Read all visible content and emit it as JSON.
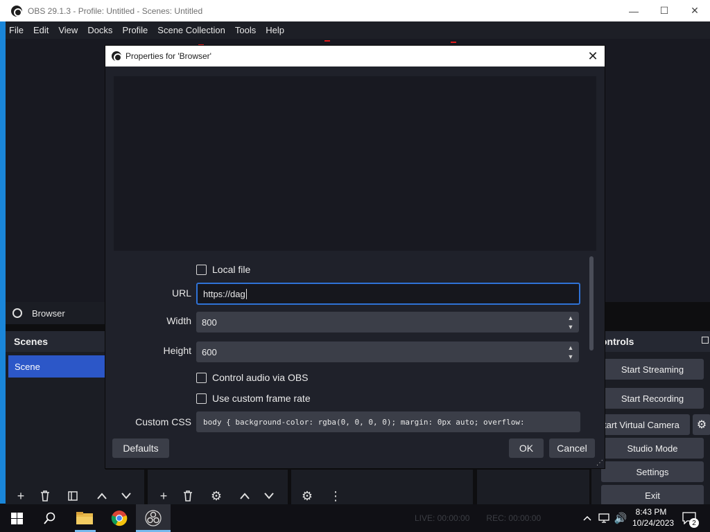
{
  "window": {
    "title": "OBS 29.1.3 - Profile: Untitled - Scenes: Untitled",
    "minimize_icon": "—",
    "maximize_icon": "☐",
    "close_icon": "✕"
  },
  "menu": [
    "File",
    "Edit",
    "View",
    "Docks",
    "Profile",
    "Scene Collection",
    "Tools",
    "Help"
  ],
  "source_bar": {
    "label": "Browser"
  },
  "scenes_dock": {
    "title": "Scenes",
    "items": [
      "Scene"
    ]
  },
  "controls_dock": {
    "title": "ontrols",
    "buttons": [
      "Start Streaming",
      "Start Recording",
      "tart Virtual Camera",
      "Studio Mode",
      "Settings",
      "Exit"
    ]
  },
  "dialog": {
    "title": "Properties for 'Browser'",
    "local_file_label": "Local file",
    "local_file_checked": false,
    "url_label": "URL",
    "url_value": "https://dag",
    "width_label": "Width",
    "width_value": "800",
    "height_label": "Height",
    "height_value": "600",
    "control_audio_label": "Control audio via OBS",
    "control_audio_checked": false,
    "custom_fps_label": "Use custom frame rate",
    "custom_fps_checked": false,
    "custom_css_label": "Custom CSS",
    "custom_css_value": "body { background-color: rgba(0, 0, 0, 0); margin: 0px auto; overflow:",
    "defaults_button": "Defaults",
    "ok_button": "OK",
    "cancel_button": "Cancel"
  },
  "statusbar": {
    "live": "LIVE: 00:00:00",
    "rec": "REC: 00:00:00"
  },
  "taskbar": {
    "time": "8:43 PM",
    "date": "10/24/2023",
    "notification_count": "2"
  },
  "colors": {
    "accent_blue": "#2c57c8",
    "focus_border": "#2f72d6",
    "window_bg": "#1f212a"
  }
}
